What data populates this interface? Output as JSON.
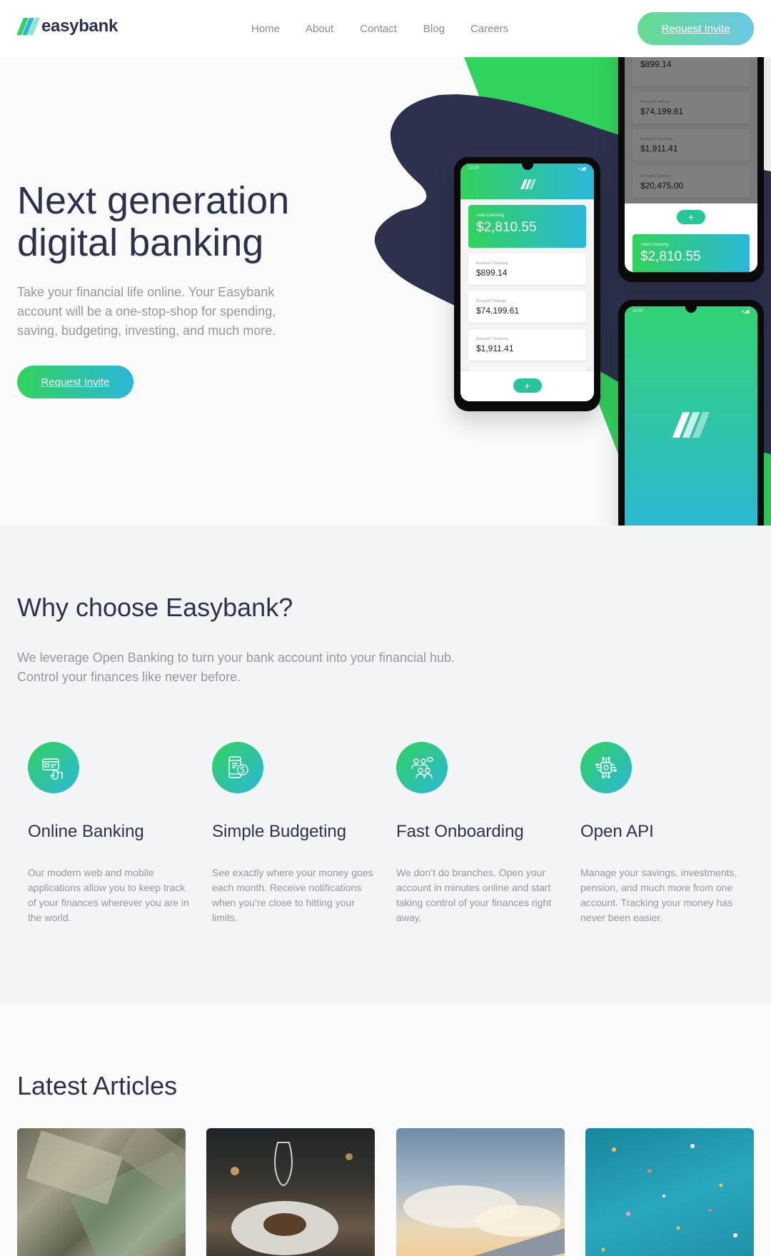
{
  "brand": {
    "name": "easybank"
  },
  "nav": {
    "links": [
      "Home",
      "About",
      "Contact",
      "Blog",
      "Careers"
    ],
    "cta": "Request Invite"
  },
  "hero": {
    "title": "Next generation digital banking",
    "text": "Take your financial life online. Your Easybank account will be a one-stop-shop for spending, saving, budgeting, investing, and much more.",
    "cta": "Request Invite"
  },
  "phones": {
    "status_time": "14:07",
    "status_icons": "▾◢▮",
    "total_label": "Total Checking",
    "total_value": "$2,810.55",
    "plus": "+",
    "accounts": [
      {
        "label": "Account 1 Checking",
        "value": "$899.14"
      },
      {
        "label": "Account 2 Savings",
        "value": "$74,199.61"
      },
      {
        "label": "Account 2 Checking",
        "value": "$1,911.41"
      },
      {
        "label": "Account 2 Savings",
        "value": "$20,475.00"
      }
    ]
  },
  "why": {
    "title": "Why choose Easybank?",
    "text": "We leverage Open Banking to turn your bank account into your financial hub. Control your finances like never before.",
    "features": [
      {
        "icon": "online-banking-icon",
        "title": "Online Banking",
        "text": "Our modern web and mobile applications allow you to keep track of your finances wherever you are in the world."
      },
      {
        "icon": "budgeting-icon",
        "title": "Simple Budgeting",
        "text": "See exactly where your money goes each month. Receive notifications when you’re close to hitting your limits."
      },
      {
        "icon": "onboarding-icon",
        "title": "Fast Onboarding",
        "text": "We don’t do branches. Open your account in minutes online and start taking control of your finances right away."
      },
      {
        "icon": "api-icon",
        "title": "Open API",
        "text": "Manage your savings, investments, pension, and much more from one account. Tracking your money has never been easier."
      }
    ]
  },
  "articles": {
    "title": "Latest Articles"
  },
  "colors": {
    "dark_blue": "#2d314d",
    "lime_green": "#31d35c",
    "bright_cyan": "#2bb7da",
    "grayish_blue": "#9597a0",
    "light_gray": "#f3f4f6"
  }
}
